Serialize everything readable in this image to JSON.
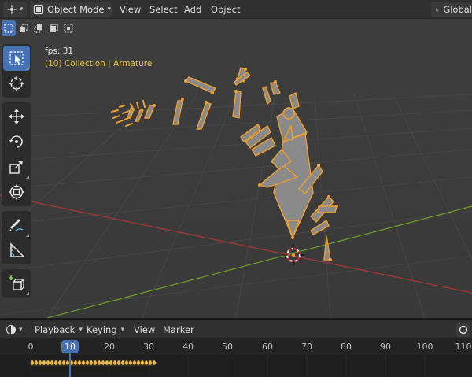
{
  "header": {
    "mode": "Object Mode",
    "menus": [
      "View",
      "Select",
      "Add",
      "Object"
    ],
    "orientation": "Global"
  },
  "viewport": {
    "fps_text": "fps: 31",
    "collection_text": "(10) Collection | Armature"
  },
  "toolbar": {
    "tools": [
      "select-box",
      "cursor",
      "move",
      "rotate",
      "scale",
      "transform",
      "annotate",
      "measure",
      "add-cube"
    ],
    "active_tool": "select-box"
  },
  "timeline": {
    "menus": [
      "Playback",
      "Keying",
      "View",
      "Marker"
    ],
    "frame_ticks": [
      "0",
      "10",
      "20",
      "30",
      "40",
      "50",
      "60",
      "70",
      "80",
      "90",
      "100",
      "110"
    ],
    "current_frame": "10",
    "keyframe_range": [
      0,
      31
    ]
  },
  "colors": {
    "accent": "#4772b3",
    "bone_outline": "#f0a030",
    "collection_text": "#e8c244",
    "x_axis": "#a53838",
    "y_axis": "#6a9a2a",
    "keyframe": "#e8b84a"
  }
}
